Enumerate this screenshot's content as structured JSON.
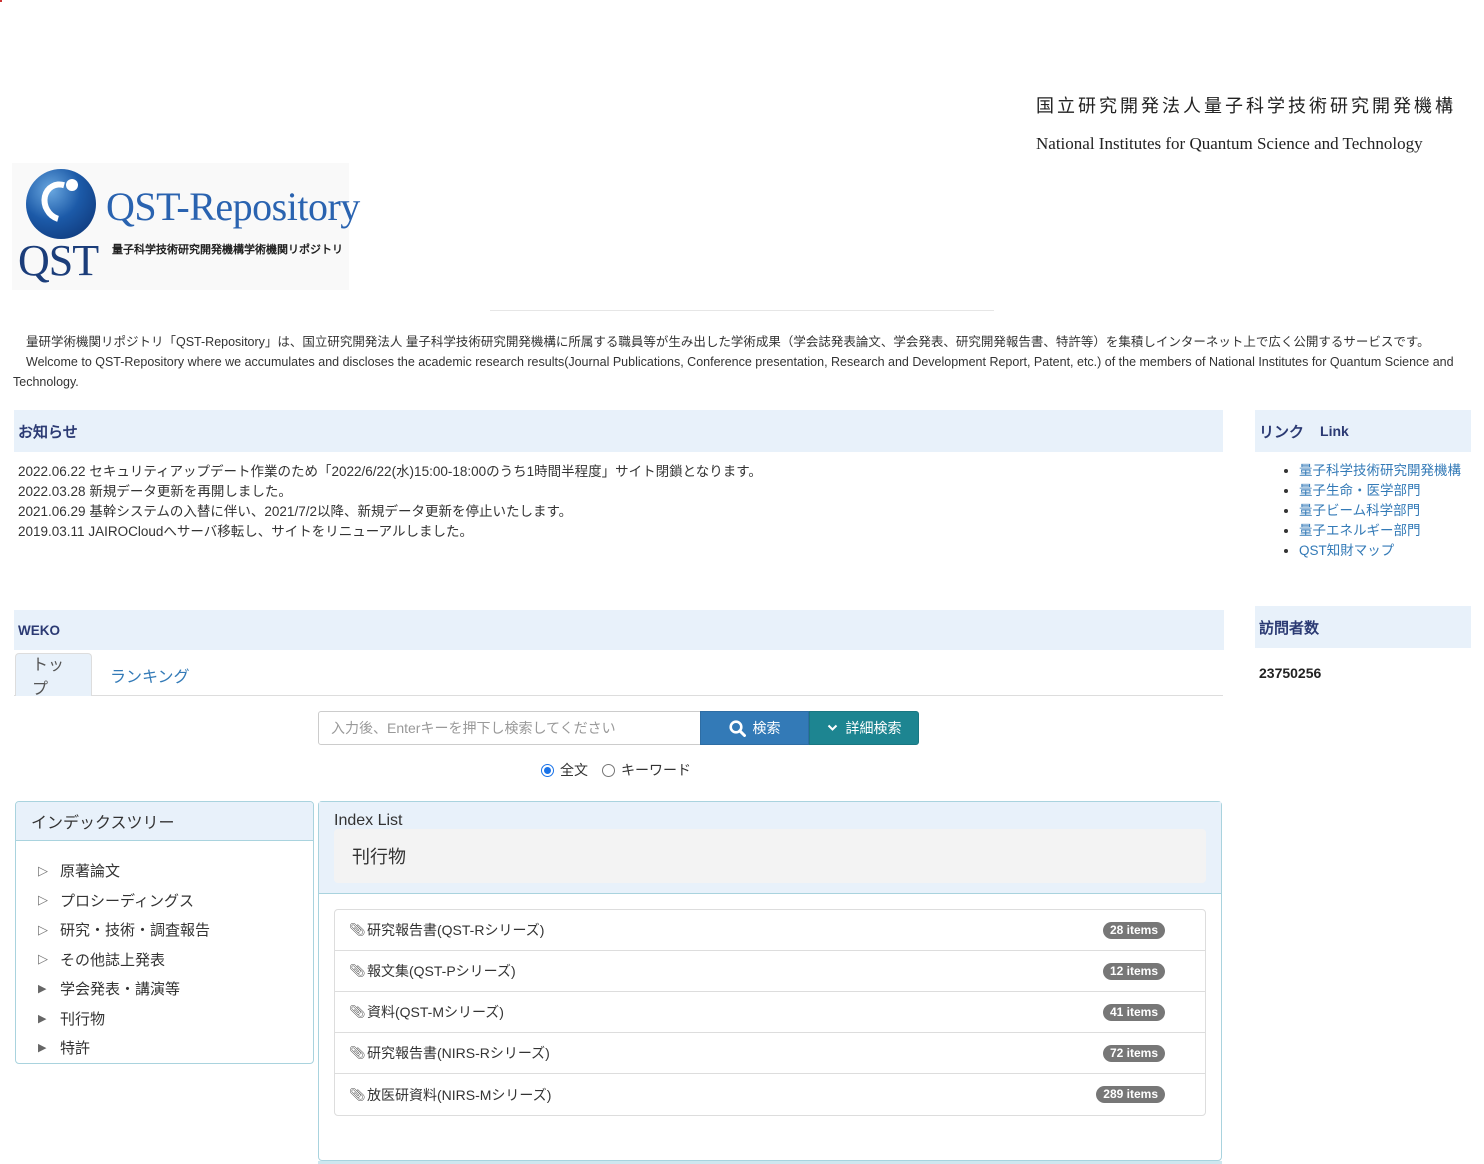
{
  "header": {
    "org_name_jp": "国立研究開発法人量子科学技術研究開発機構",
    "org_name_en": "National Institutes for Quantum Science and Technology",
    "logo": {
      "brand": "QST-Repository",
      "mark": "QST",
      "subtitle": "量子科学技術研究開発機構学術機関リポジトリ"
    }
  },
  "intro": {
    "jp": "量研学術機関リポジトリ「QST-Repository」は、国立研究開発法人 量子科学技術研究開発機構に所属する職員等が生み出した学術成果（学会誌発表論文、学会発表、研究開発報告書、特許等）を集積しインターネット上で広く公開するサービスです。",
    "en": "Welcome to QST-Repository where we accumulates and discloses the academic research results(Journal Publications, Conference presentation, Research and Development Report, Patent, etc.) of the members of National Institutes for Quantum Science and Technology."
  },
  "news": {
    "title": "お知らせ",
    "items": [
      "2022.06.22 セキュリティアップデート作業のため「2022/6/22(水)15:00-18:00のうち1時間半程度」サイト閉鎖となります。",
      "2022.03.28 新規データ更新を再開しました。",
      "2021.06.29 基幹システムの入替に伴い、2021/7/2以降、新規データ更新を停止いたします。",
      "2019.03.11 JAIROCloudへサーバ移転し、サイトをリニューアルしました。"
    ]
  },
  "links": {
    "title_jp": "リンク",
    "title_en": "Link",
    "items": [
      "量子科学技術研究開発機構",
      "量子生命・医学部門",
      "量子ビーム科学部門",
      "量子エネルギー部門",
      "QST知財マップ"
    ]
  },
  "visitors": {
    "title": "訪問者数",
    "count": "23750256"
  },
  "weko": {
    "title": "WEKO",
    "tabs": [
      {
        "label": "トップ",
        "active": true
      },
      {
        "label": "ランキング",
        "active": false
      }
    ],
    "search": {
      "placeholder": "入力後、Enterキーを押下し検索してください",
      "value": "",
      "search_button": "検索",
      "advanced_button": "詳細検索",
      "options": [
        {
          "label": "全文",
          "selected": true
        },
        {
          "label": "キーワード",
          "selected": false
        }
      ]
    },
    "index_tree": {
      "title": "インデックスツリー",
      "items": [
        {
          "label": "原著論文",
          "expandable": false
        },
        {
          "label": "プロシーディングス",
          "expandable": false
        },
        {
          "label": "研究・技術・調査報告",
          "expandable": false
        },
        {
          "label": "その他誌上発表",
          "expandable": false
        },
        {
          "label": "学会発表・講演等",
          "expandable": true
        },
        {
          "label": "刊行物",
          "expandable": true
        },
        {
          "label": "特許",
          "expandable": true
        }
      ]
    },
    "index_list": {
      "title": "Index List",
      "current": "刊行物",
      "rows": [
        {
          "label": "研究報告書(QST-Rシリーズ)",
          "count": "28 items"
        },
        {
          "label": "報文集(QST-Pシリーズ)",
          "count": "12 items"
        },
        {
          "label": "資料(QST-Mシリーズ)",
          "count": "41 items"
        },
        {
          "label": "研究報告書(NIRS-Rシリーズ)",
          "count": "72 items"
        },
        {
          "label": "放医研資料(NIRS-Mシリーズ)",
          "count": "289 items"
        }
      ]
    }
  },
  "colors": {
    "panel_heading_bg": "#e8f1fa",
    "panel_heading_text": "#2b3a73",
    "link": "#337ab7",
    "search_button": "#337ab7",
    "advanced_button": "#1d8591",
    "badge": "#777777",
    "panel_border": "#a9d3de"
  }
}
